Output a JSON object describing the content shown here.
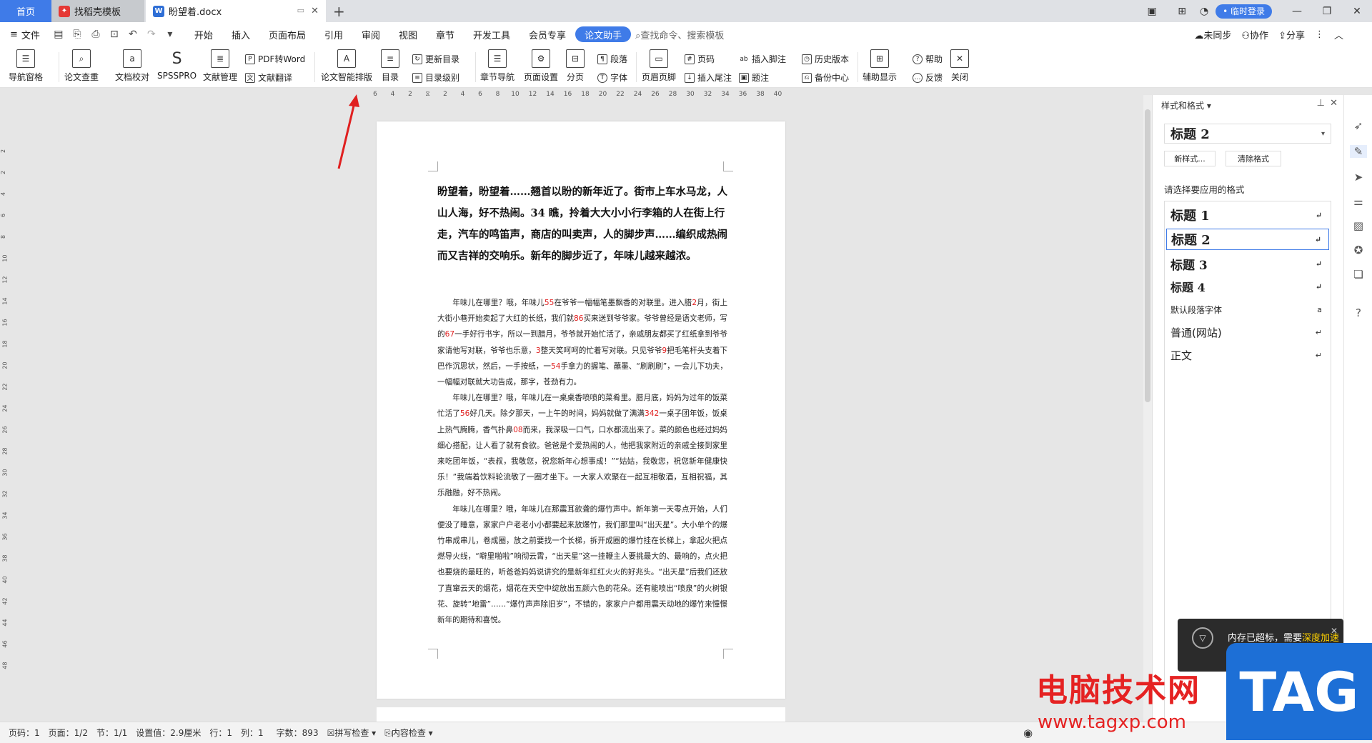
{
  "tabs": {
    "home": "首页",
    "template": "找稻壳模板",
    "doc": "盼望着.docx",
    "add": "+"
  },
  "titlebar": {
    "login": "• 临时登录"
  },
  "menu": {
    "file": "文件",
    "items": [
      "开始",
      "插入",
      "页面布局",
      "引用",
      "审阅",
      "视图",
      "章节",
      "开发工具",
      "会员专享",
      "论文助手"
    ],
    "search": "查找命令、搜索模板",
    "sync": "未同步",
    "collab": "协作",
    "share": "分享"
  },
  "ribbon": {
    "nav_pane": "导航窗格",
    "paper_check": "论文查重",
    "doc_proof": "文档校对",
    "spsspro": "SPSSPRO",
    "ref_manage": "文献管理",
    "pdf_word": "PDF转Word",
    "ref_translate": "文献翻译",
    "smart_layout": "论文智能排版",
    "toc": "目录",
    "update_toc": "更新目录",
    "toc_level": "目录级别",
    "section_nav": "章节导航",
    "page_setup": "页面设置",
    "page_break": "分页",
    "paragraph": "段落",
    "font": "字体",
    "header_footer": "页眉页脚",
    "page_number": "页码",
    "insert_footnote": "插入脚注",
    "insert_endnote": "插入尾注",
    "caption": "题注",
    "history": "历史版本",
    "backup": "备份中心",
    "aux_display": "辅助显示",
    "help": "帮助",
    "feedback": "反馈",
    "close": "关闭"
  },
  "ruler_top": [
    "6",
    "4",
    "2",
    "",
    "2",
    "4",
    "6",
    "8",
    "10",
    "12",
    "14",
    "16",
    "18",
    "20",
    "22",
    "24",
    "26",
    "28",
    "30",
    "32",
    "34",
    "36",
    "38",
    "40"
  ],
  "ruler_left": [
    "2",
    "2",
    "4",
    "6",
    "8",
    "10",
    "12",
    "14",
    "16",
    "18",
    "20",
    "22",
    "24",
    "26",
    "28",
    "30",
    "32",
    "34",
    "36",
    "38",
    "40",
    "42",
    "44",
    "46",
    "48"
  ],
  "document": {
    "heading": "盼望着，盼望着……翘首以盼的新年近了。街市上车水马龙，人山人海，好不热闹。34 瞧，拎着大大小小行李箱的人在街上行走，汽车的鸣笛声，商店的叫卖声，人的脚步声……编织成热闹而又吉祥的交响乐。新年的脚步近了，年味儿越来越浓。",
    "p1": [
      {
        "t": "年味儿在哪里？哦，年味儿"
      },
      {
        "t": "55",
        "r": true
      },
      {
        "t": "在爷爷一幅幅笔墨飘香的对联里。进入腊"
      },
      {
        "t": "2",
        "r": true
      },
      {
        "t": "月，街上大街小巷开始卖起了大红的长纸，我们就"
      },
      {
        "t": "86",
        "r": true
      },
      {
        "t": "买来送到爷爷家。爷爷曾经是语文老师，写的"
      },
      {
        "t": "67",
        "r": true
      },
      {
        "t": "一手好行书字，所以一到腊月，爷爷就开始忙活了，亲戚朋友都买了红纸拿到爷爷家请他写对联，爷爷也乐意，"
      },
      {
        "t": "3",
        "r": true
      },
      {
        "t": "整天笑呵呵的忙着写对联。只见爷爷"
      },
      {
        "t": "9",
        "r": true
      },
      {
        "t": "把毛笔杆头支着下巴作沉思状，然后，一手按纸，一"
      },
      {
        "t": "54",
        "r": true
      },
      {
        "t": "手拿力的握笔、蘸墨、“刷刷刷”，一会儿下功夫，一幅幅对联就大功告成，那字，苍劲有力。"
      }
    ],
    "p2": [
      {
        "t": "年味儿在哪里？哦，年味儿在一桌桌香喷喷的菜肴里。腊月底，妈妈为过年的饭菜忙活了"
      },
      {
        "t": "56",
        "r": true
      },
      {
        "t": "好几天。除夕那天，一上午的时间，妈妈就做了满满"
      },
      {
        "t": "342",
        "r": true
      },
      {
        "t": "一桌子团年饭，饭桌上热气腾腾，香气扑鼻"
      },
      {
        "t": "08",
        "r": true
      },
      {
        "t": "而来，我深吸一口气，口水都流出来了。菜的颜色也经过妈妈细心搭配，让人看了就有食欲。爸爸是个爱热闹的人，他把我家附近的亲戚全接到家里来吃团年饭，“表叔，我敬您，祝您新年心想事成！”“姑姑，我敬您，祝您新年健康快乐！”我端着饮料轮流敬了一圈才坐下。一大家人欢聚在一起互相敬酒，互相祝福，其乐融融，好不热闹。"
      }
    ],
    "p3": [
      {
        "t": "年味儿在哪里？哦，年味儿在那震耳欲聋的爆竹声中。新年第一天零点开始，人们便没了睡意，家家户户老老小小都要起来放爆竹，我们那里叫“出天星”。大小单个的爆竹串成串儿，卷成圈，放之前要找一个长梯，拆开成圈的爆竹挂在长梯上，拿起火把点燃导火线，“噼里啪啦”响彻云霄，“出天星”这一挂鞭主人要挑最大的、最响的，点火把也要烧的最旺的，听爸爸妈妈说讲究的是新年红红火火的好兆头。“出天星”后我们还放了直窜云天的烟花，烟花在天空中绽放出五颜六色的花朵。还有能喷出“喷泉”的火树银花、旋转“地雷”……“爆竹声声除旧岁”，不错的，家家户户都用震天动地的爆竹来憧憬新年的期待和喜悦。"
      }
    ]
  },
  "panel": {
    "title": "样式和格式",
    "current_style": "标题 2",
    "new_style": "新样式...",
    "clear_format": "清除格式",
    "choose_label": "请选择要应用的格式",
    "styles": [
      "标题 1",
      "标题 2",
      "标题 3",
      "标题 4",
      "默认段落字体",
      "普通(网站)",
      "正文"
    ]
  },
  "status": {
    "page_num": "页码：1",
    "pages": "页面：1/2",
    "section": "节：1/1",
    "setting": "设置值：2.9厘米",
    "row": "行：1",
    "col": "列：1",
    "words": "字数：893",
    "spell": "拼写检查",
    "content_check": "内容检查"
  },
  "popup": {
    "text": "内存已超标，需要",
    "link": "深度加速"
  },
  "watermark": {
    "text": "电脑技术网",
    "url": "www.tagxp.com",
    "tag": "TAG"
  },
  "colors": {
    "accent": "#3f7be8",
    "red_num": "#e02020",
    "watermark": "#e52222"
  }
}
